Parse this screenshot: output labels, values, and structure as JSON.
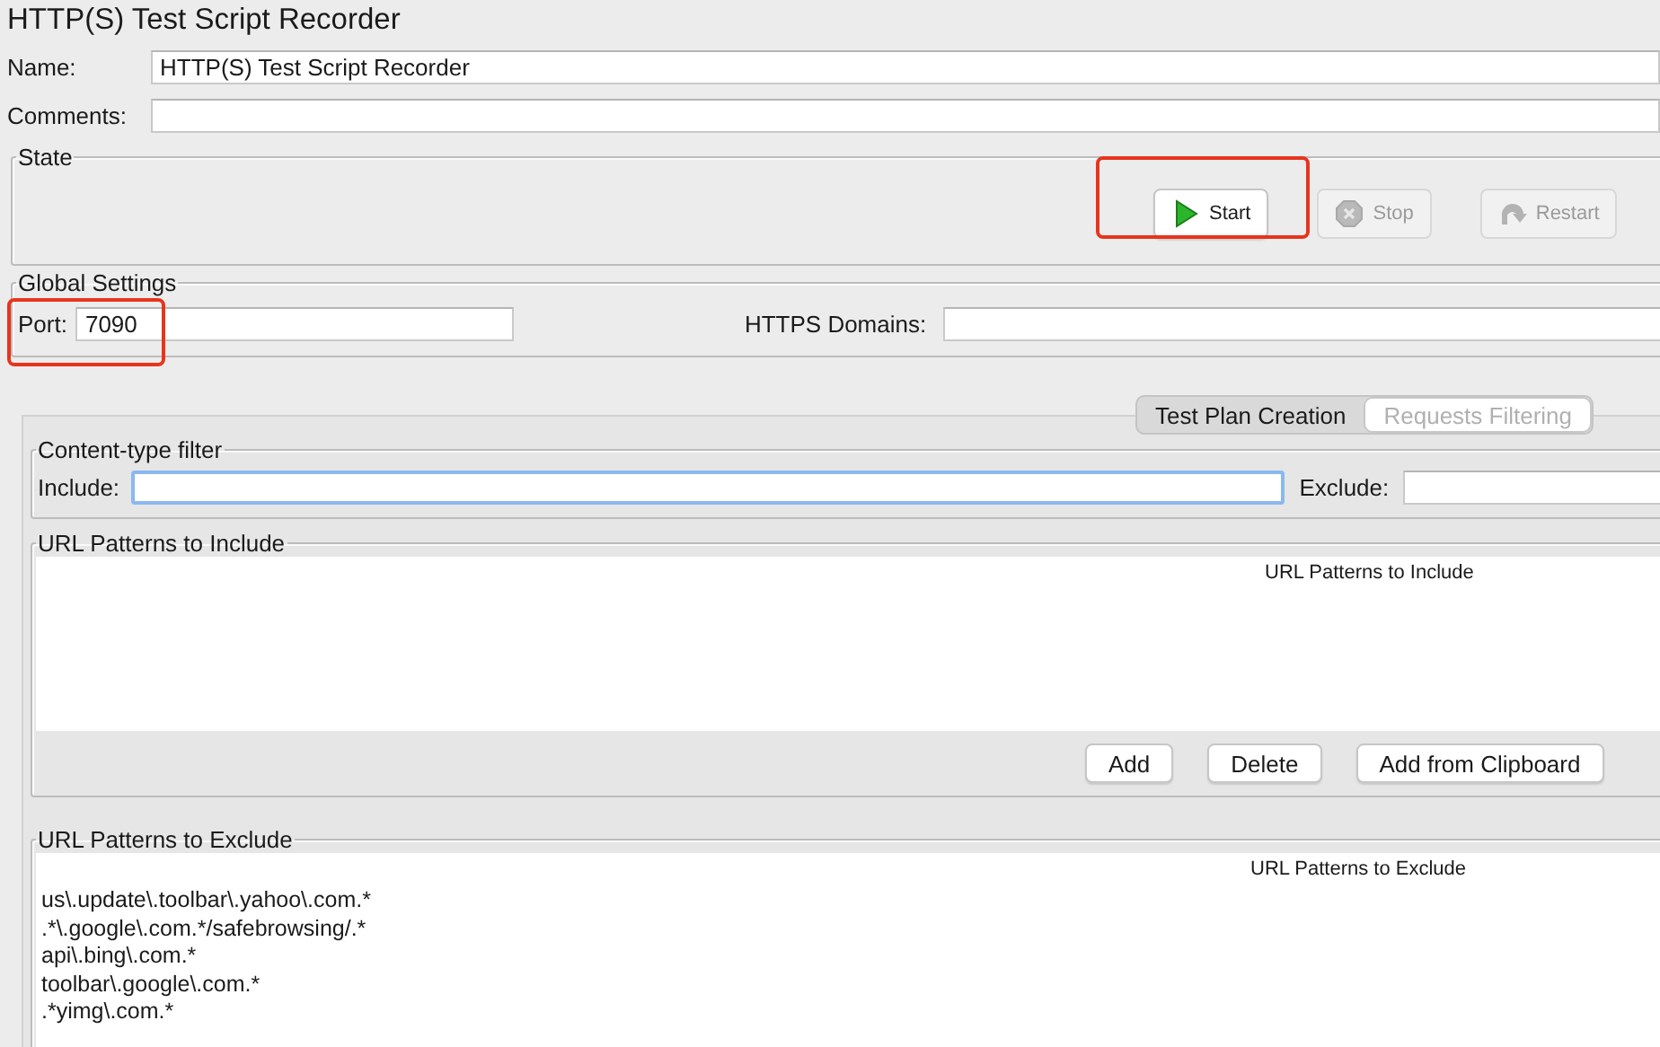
{
  "window": {
    "title": "HTTP(S) Test Script Recorder"
  },
  "name": {
    "label": "Name:",
    "value": "HTTP(S) Test Script Recorder"
  },
  "comments": {
    "label": "Comments:"
  },
  "state": {
    "title": "State",
    "buttons": [
      {
        "kind": "start",
        "label": "Start",
        "disabled": false,
        "highlighted": true
      },
      {
        "kind": "stop",
        "label": "Stop",
        "disabled": true,
        "highlighted": false
      },
      {
        "kind": "restart",
        "label": "Restart",
        "disabled": true,
        "highlighted": false
      }
    ]
  },
  "global_settings": {
    "title": "Global Settings",
    "port": {
      "label": "Port:",
      "value": "7090",
      "highlighted": true
    },
    "https_domains": {
      "label": "HTTPS Domains:"
    }
  },
  "tabs": [
    {
      "label": "Test Plan Creation",
      "selected": false
    },
    {
      "label": "Requests Filtering",
      "selected": true
    }
  ],
  "content_type_filter": {
    "title": "Content-type filter",
    "include": {
      "label": "Include:",
      "focused": true
    },
    "exclude": {
      "label": "Exclude:",
      "focused": false
    }
  },
  "include_patterns": {
    "title": "URL Patterns to Include",
    "column": "URL Patterns to Include",
    "buttons": [
      {
        "label": "Add"
      },
      {
        "label": "Delete"
      },
      {
        "label": "Add from Clipboard"
      }
    ]
  },
  "exclude_patterns": {
    "title": "URL Patterns to Exclude",
    "column": "URL Patterns to Exclude",
    "rows": [
      "us\\.update\\.toolbar\\.yahoo\\.com.*",
      ".*\\.google\\.com.*/safebrowsing/.*",
      "api\\.bing\\.com.*",
      "toolbar\\.google\\.com.*",
      ".*yimg\\.com.*"
    ]
  }
}
